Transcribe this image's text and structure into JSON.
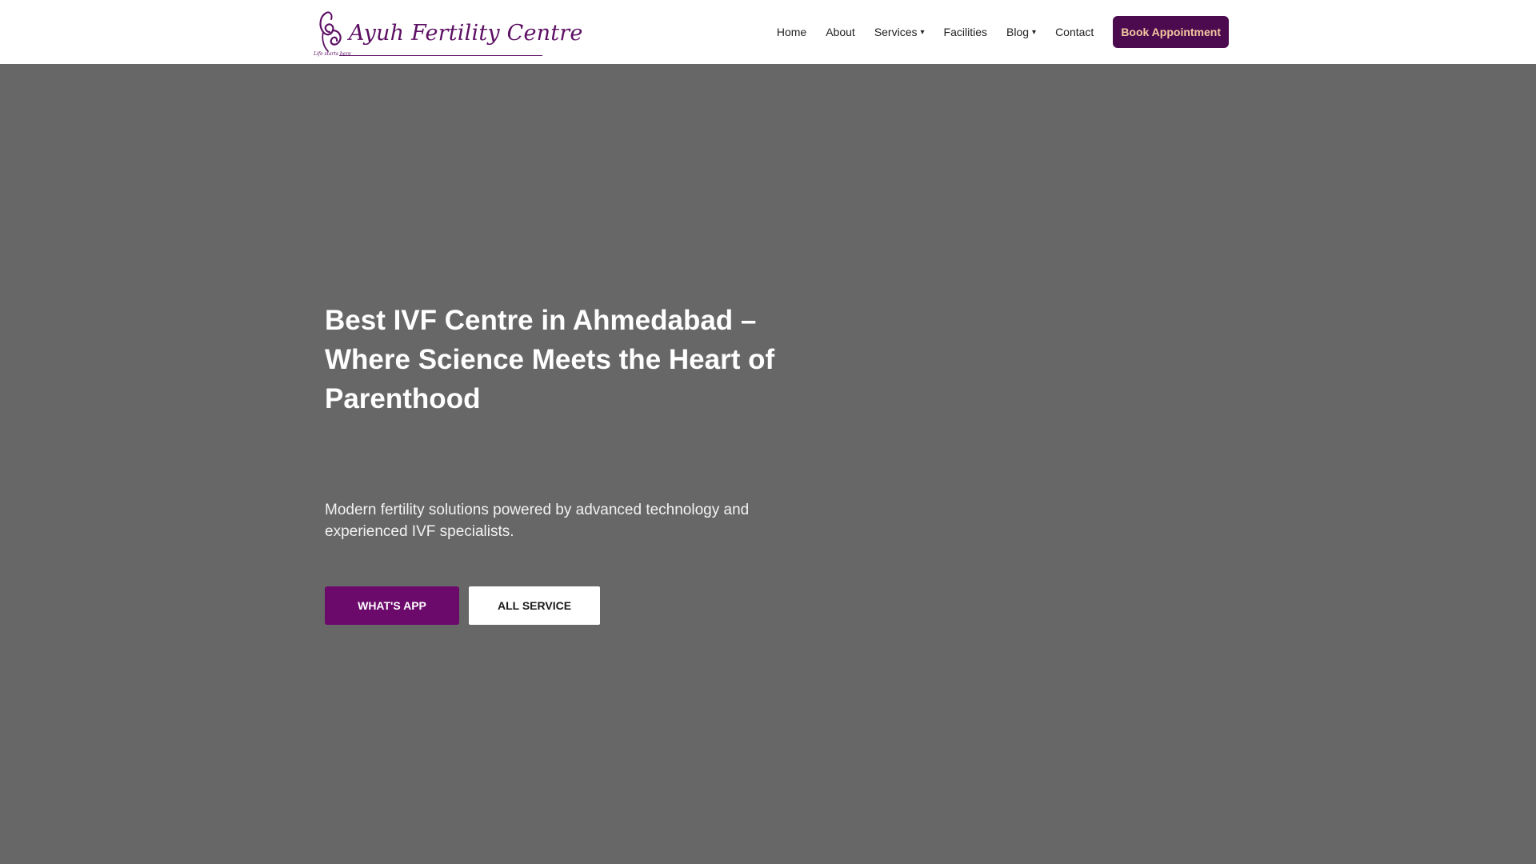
{
  "header": {
    "logo": {
      "name": "Ayuh Fertility Centre",
      "tagline": "Life starts here"
    },
    "nav": [
      {
        "label": "Home",
        "has_dropdown": false
      },
      {
        "label": "About",
        "has_dropdown": false
      },
      {
        "label": "Services",
        "has_dropdown": true
      },
      {
        "label": "Facilities",
        "has_dropdown": false
      },
      {
        "label": "Blog",
        "has_dropdown": true
      },
      {
        "label": "Contact",
        "has_dropdown": false
      }
    ],
    "dropdown_caret": "▾",
    "cta_label": "Book Appointment"
  },
  "hero": {
    "title": "Best IVF Centre in Ahmedabad – Where Science Meets the Heart of Parenthood",
    "subtitle": "Modern fertility solutions powered by advanced technology and experienced IVF specialists.",
    "primary_button": "WHAT'S APP",
    "secondary_button": "ALL SERVICE"
  },
  "colors": {
    "brand_purple": "#5c0f63",
    "cta_bg": "#4d0b4f",
    "cta_text": "#f3c8a0",
    "whatsapp_bg": "#6b0a6b",
    "hero_bg": "#676767",
    "header_bg": "#ffffff"
  },
  "icons": {
    "logo_mark": "fertility-logo-icon",
    "dropdown": "chevron-down-icon"
  }
}
